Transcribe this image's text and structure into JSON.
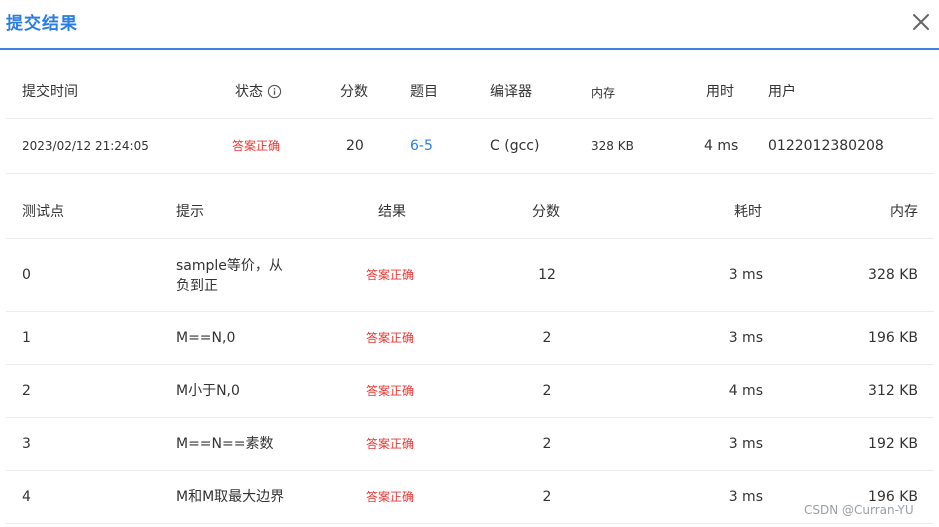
{
  "dialog": {
    "title": "提交结果"
  },
  "submission": {
    "headers": {
      "time": "提交时间",
      "status": "状态",
      "score": "分数",
      "problem": "题目",
      "compiler": "编译器",
      "memory": "内存",
      "time_used": "用时",
      "user": "用户"
    },
    "row": {
      "time": "2023/02/12 21:24:05",
      "status": "答案正确",
      "score": "20",
      "problem": "6-5",
      "compiler": "C (gcc)",
      "memory": "328 KB",
      "time_used": "4 ms",
      "user": "0122012380208"
    }
  },
  "testcases": {
    "headers": {
      "id": "测试点",
      "hint": "提示",
      "result": "结果",
      "score": "分数",
      "time": "耗时",
      "memory": "内存"
    },
    "rows": [
      {
        "id": "0",
        "hint": "sample等价，从负到正",
        "result": "答案正确",
        "score": "12",
        "time": "3 ms",
        "memory": "328 KB"
      },
      {
        "id": "1",
        "hint": "M==N,0",
        "result": "答案正确",
        "score": "2",
        "time": "3 ms",
        "memory": "196 KB"
      },
      {
        "id": "2",
        "hint": "M小于N,0",
        "result": "答案正确",
        "score": "2",
        "time": "4 ms",
        "memory": "312 KB"
      },
      {
        "id": "3",
        "hint": "M==N==素数",
        "result": "答案正确",
        "score": "2",
        "time": "3 ms",
        "memory": "192 KB"
      },
      {
        "id": "4",
        "hint": "M和M取最大边界",
        "result": "答案正确",
        "score": "2",
        "time": "3 ms",
        "memory": "196 KB"
      }
    ]
  },
  "watermark": "CSDN @Curran-YU",
  "colors": {
    "accent": "#2a7de1",
    "status_ok": "#e53935",
    "divider": "#ececec"
  },
  "icons": {
    "close": "close-icon",
    "info": "info-icon"
  }
}
